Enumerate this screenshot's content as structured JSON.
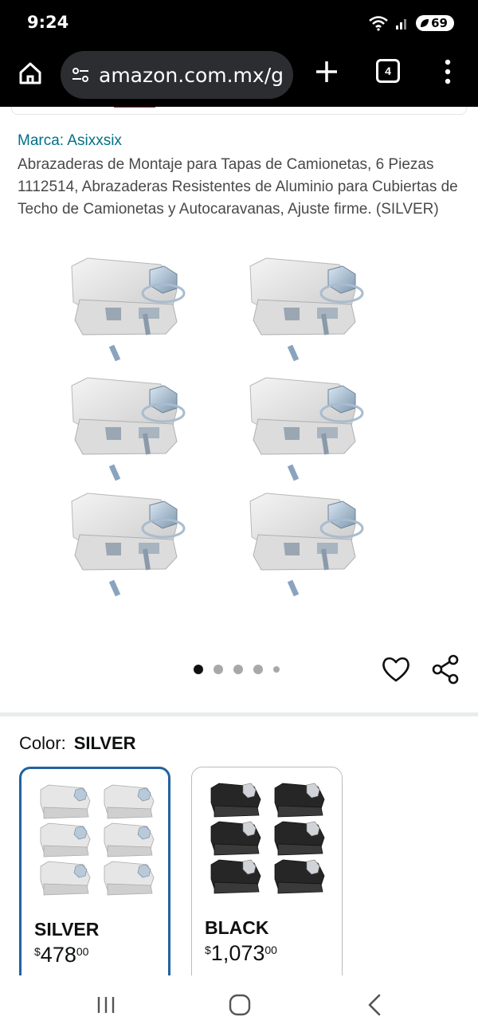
{
  "status": {
    "time": "9:24",
    "battery": "69"
  },
  "browser": {
    "url": "amazon.com.mx/g",
    "tab_count": "4"
  },
  "product": {
    "brand": "Marca: Asixxsix",
    "title": "Abrazaderas de Montaje para Tapas de Camionetas, 6 Piezas 1112514, Abrazaderas Resistentes de Aluminio para Cubiertas de Techo de Camionetas y Autocaravanas, Ajuste firme. (SILVER)",
    "gallery": {
      "image_count": 5,
      "active_index": 0
    }
  },
  "color": {
    "label": "Color:",
    "selected": "SILVER",
    "options": [
      {
        "name": "SILVER",
        "currency": "$",
        "whole": "478",
        "cents": "00",
        "sub": ""
      },
      {
        "name": "BLACK",
        "currency": "$",
        "whole": "1,073",
        "cents": "00",
        "sub": ""
      }
    ]
  },
  "colors": {
    "accent": "#2162a1",
    "link": "#007185",
    "text": "#0f1111"
  }
}
